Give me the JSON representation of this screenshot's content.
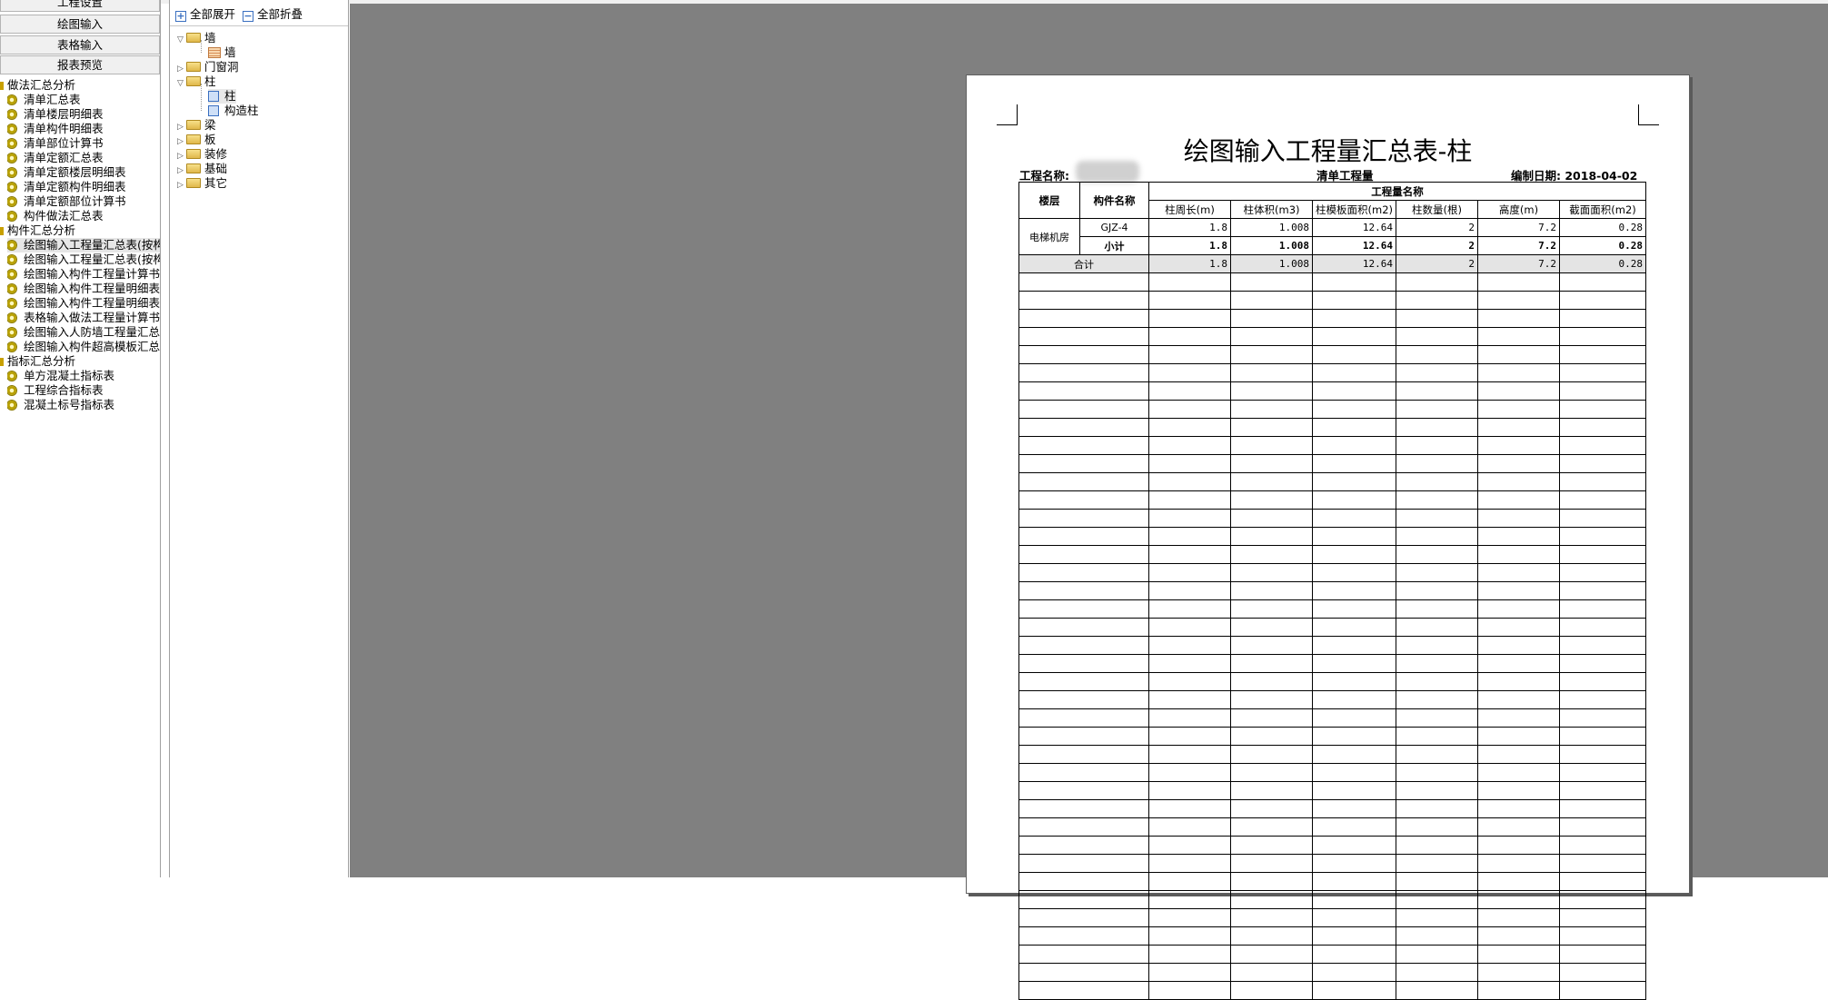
{
  "nav_buttons": [
    "工程设置",
    "绘图输入",
    "表格输入",
    "报表预览"
  ],
  "report_tree": [
    {
      "group": "做法汇总分析",
      "items": [
        "清单汇总表",
        "清单楼层明细表",
        "清单构件明细表",
        "清单部位计算书",
        "清单定额汇总表",
        "清单定额楼层明细表",
        "清单定额构件明细表",
        "清单定额部位计算书",
        "构件做法汇总表"
      ]
    },
    {
      "group": "构件汇总分析",
      "items": [
        "绘图输入工程量汇总表(按构",
        "绘图输入工程量汇总表(按构",
        "绘图输入构件工程量计算书",
        "绘图输入构件工程量明细表",
        "绘图输入构件工程量明细表",
        "表格输入做法工程量计算书",
        "绘图输入人防墙工程量汇总",
        "绘图输入构件超高模板汇总"
      ]
    },
    {
      "group": "指标汇总分析",
      "items": [
        "单方混凝土指标表",
        "工程综合指标表",
        "混凝土标号指标表"
      ]
    }
  ],
  "selected_report_item": "绘图输入工程量汇总表(按构",
  "toolbar": {
    "expand_all": "全部展开",
    "collapse_all": "全部折叠"
  },
  "component_tree": [
    {
      "label": "墙",
      "level": 0,
      "expanded": true,
      "icon": "folder-open-icon"
    },
    {
      "label": "墙",
      "level": 1,
      "icon": "wall-icon"
    },
    {
      "label": "门窗洞",
      "level": 0,
      "expanded": false,
      "icon": "folder-icon"
    },
    {
      "label": "柱",
      "level": 0,
      "expanded": true,
      "icon": "folder-open-icon"
    },
    {
      "label": "柱",
      "level": 1,
      "icon": "column-icon",
      "selected": true
    },
    {
      "label": "构造柱",
      "level": 1,
      "icon": "construct-column-icon"
    },
    {
      "label": "梁",
      "level": 0,
      "expanded": false,
      "icon": "folder-icon"
    },
    {
      "label": "板",
      "level": 0,
      "expanded": false,
      "icon": "folder-icon"
    },
    {
      "label": "装修",
      "level": 0,
      "expanded": false,
      "icon": "folder-icon"
    },
    {
      "label": "基础",
      "level": 0,
      "expanded": false,
      "icon": "folder-icon"
    },
    {
      "label": "其它",
      "level": 0,
      "expanded": false,
      "icon": "folder-icon"
    }
  ],
  "report": {
    "title": "绘图输入工程量汇总表-柱",
    "project_label": "工程名称:",
    "center_label": "清单工程量",
    "date_label": "编制日期: 2018-04-02",
    "headers": {
      "floor": "楼层",
      "component": "构件名称",
      "group": "工程量名称"
    },
    "columns": [
      "柱周长(m)",
      "柱体积(m3)",
      "柱模板面积(m2)",
      "柱数量(根)",
      "高度(m)",
      "截面面积(m2)"
    ],
    "floor_name": "电梯机房",
    "rows": [
      {
        "name": "GJZ-4",
        "values": [
          "1.8",
          "1.008",
          "12.64",
          "2",
          "7.2",
          "0.28"
        ]
      },
      {
        "name": "小计",
        "values": [
          "1.8",
          "1.008",
          "12.64",
          "2",
          "7.2",
          "0.28"
        ]
      }
    ],
    "total": {
      "name": "合计",
      "values": [
        "1.8",
        "1.008",
        "12.64",
        "2",
        "7.2",
        "0.28"
      ]
    }
  }
}
